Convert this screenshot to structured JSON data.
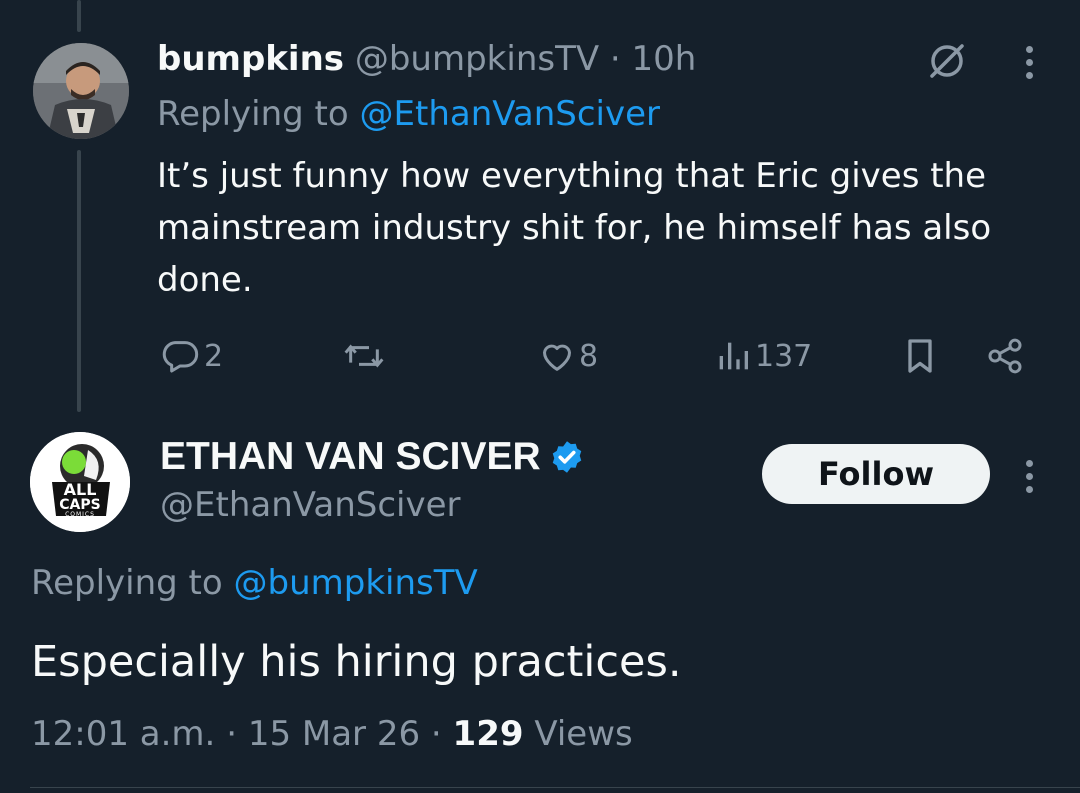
{
  "reply_tweet": {
    "display_name": "bumpkins",
    "handle": "@bumpkinsTV",
    "separator": "·",
    "time": "10h",
    "replying_prefix": "Replying to",
    "replying_handle": "@EthanVanSciver",
    "text": "It’s just funny how everything that Eric gives the mainstream industry shit for, he himself has also done.",
    "actions": {
      "replies": "2",
      "reposts": "",
      "likes": "8",
      "views": "137"
    },
    "icons": [
      "grok-icon",
      "more-icon",
      "reply-icon",
      "repost-icon",
      "like-icon",
      "views-icon",
      "bookmark-icon",
      "share-icon"
    ]
  },
  "main_tweet": {
    "display_name": "ETHAN VAN SCIVER",
    "handle": "@EthanVanSciver",
    "verified": true,
    "follow_label": "Follow",
    "replying_prefix": "Replying to",
    "replying_handle": "@bumpkinsTV",
    "text": "Especially his hiring practices.",
    "timestamp": "12:01 a.m.",
    "date": "15 Mar 26",
    "separator": "·",
    "views_count": "129",
    "views_label": "Views",
    "avatar_logo": [
      "ALL",
      "CAPS",
      "COMICS"
    ]
  },
  "colors": {
    "background": "#15202b",
    "text": "#f7f9f9",
    "muted": "#8b98a5",
    "accent": "#1d9bf0",
    "button_bg": "#eff3f4"
  }
}
